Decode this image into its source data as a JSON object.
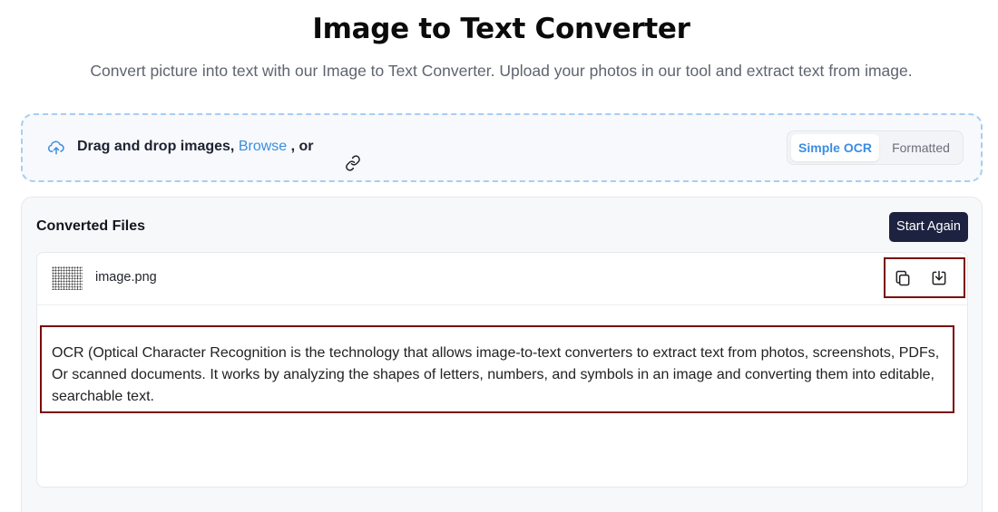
{
  "header": {
    "title": "Image to Text Converter",
    "subtitle": "Convert picture into text with our Image to Text Converter. Upload your photos in our tool and extract text from image."
  },
  "upload": {
    "prefix": "Drag and drop images,",
    "browse_label": "Browse",
    "suffix": " , or",
    "modes": {
      "simple": "Simple OCR",
      "formatted": "Formatted"
    },
    "active_mode": "Simple OCR",
    "accent_color": "#3b8de0"
  },
  "converted": {
    "title": "Converted Files",
    "start_again_label": "Start Again",
    "files": [
      {
        "name": "image.png",
        "text_lines": [
          "OCR (Optical Character Recognition is the technology that allows image-to-text converters to extract text from photos, screenshots, PDFs,",
          "Or scanned documents. It works by analyzing the shapes of letters, numbers, and symbols in an image and converting them into editable,",
          "searchable text."
        ]
      }
    ]
  },
  "icons": {
    "upload": "cloud-upload-icon",
    "link": "link-icon",
    "copy": "copy-icon",
    "download": "download-icon"
  }
}
